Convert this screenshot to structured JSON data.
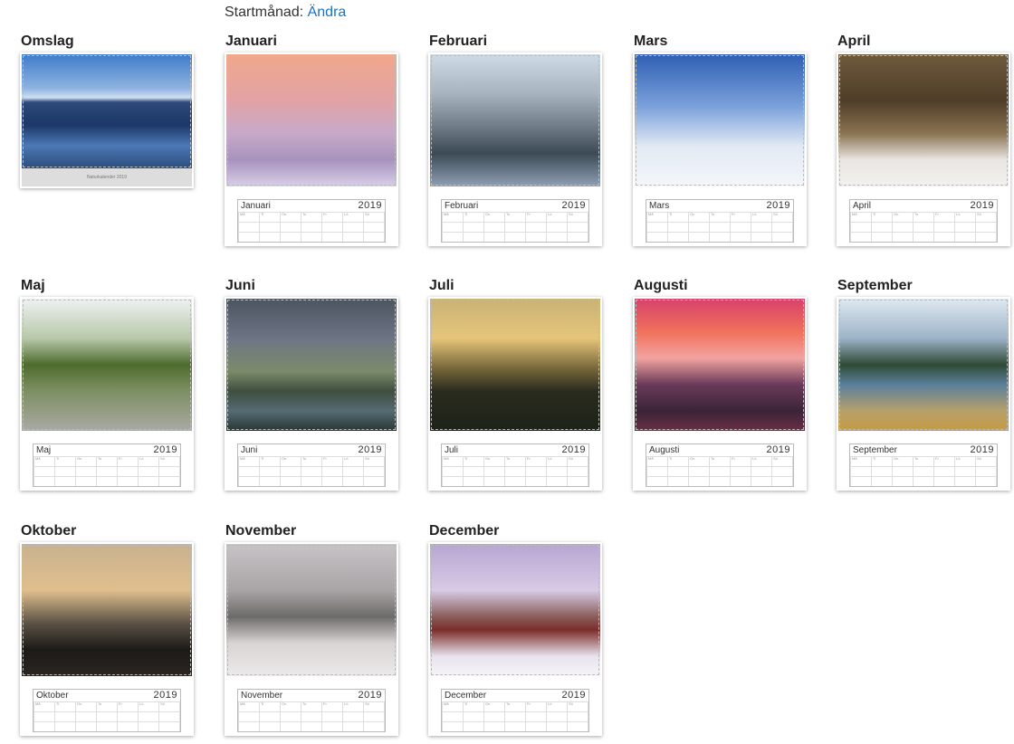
{
  "header": {
    "label": "Startmånad:",
    "link": "Ändra"
  },
  "tiles": [
    {
      "title": "Omslag",
      "cover": true,
      "caption": "Naturkalender 2019",
      "scene": "sc-lake"
    },
    {
      "title": "Januari",
      "month": "Januari",
      "year": "2019",
      "scene": "sc-pink"
    },
    {
      "title": "Februari",
      "month": "Februari",
      "year": "2019",
      "scene": "sc-frost"
    },
    {
      "title": "Mars",
      "month": "Mars",
      "year": "2019",
      "scene": "sc-bluesky"
    },
    {
      "title": "April",
      "month": "April",
      "year": "2019",
      "scene": "sc-forest"
    },
    {
      "title": "Maj",
      "month": "Maj",
      "year": "2019",
      "scene": "sc-road"
    },
    {
      "title": "Juni",
      "month": "Juni",
      "year": "2019",
      "scene": "sc-rainbow"
    },
    {
      "title": "Juli",
      "month": "Juli",
      "year": "2019",
      "scene": "sc-sunset"
    },
    {
      "title": "Augusti",
      "month": "Augusti",
      "year": "2019",
      "scene": "sc-red"
    },
    {
      "title": "September",
      "month": "September",
      "year": "2019",
      "scene": "sc-autumn"
    },
    {
      "title": "Oktober",
      "month": "Oktober",
      "year": "2019",
      "scene": "sc-dusk"
    },
    {
      "title": "November",
      "month": "November",
      "year": "2019",
      "scene": "sc-snow"
    },
    {
      "title": "December",
      "month": "December",
      "year": "2019",
      "scene": "sc-cabin"
    }
  ],
  "weekdays": [
    "Må",
    "Ti",
    "On",
    "To",
    "Fr",
    "Lö",
    "Sö"
  ]
}
